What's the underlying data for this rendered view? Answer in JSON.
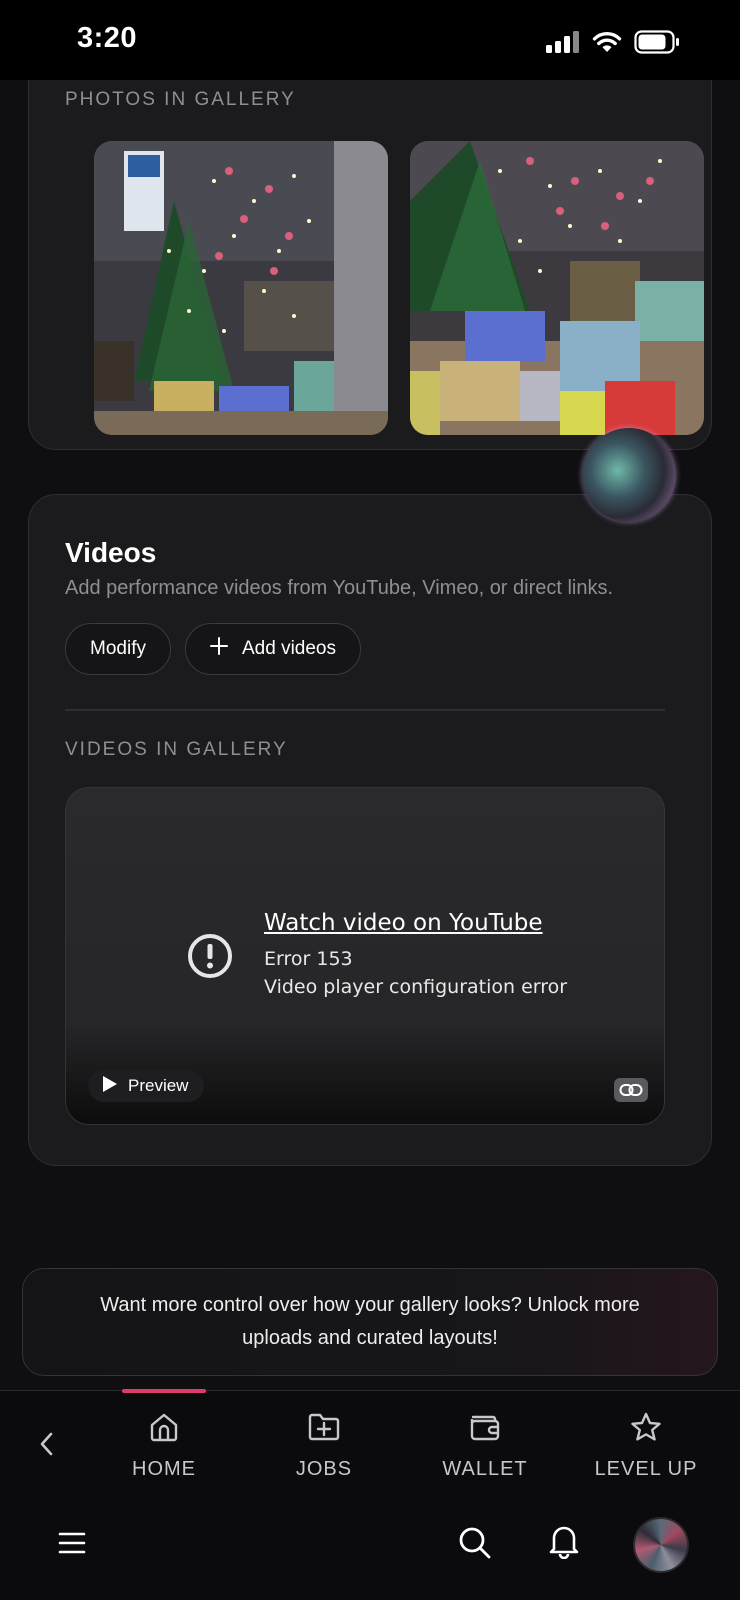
{
  "status_bar": {
    "time": "3:20"
  },
  "photos_section": {
    "label": "PHOTOS IN GALLERY"
  },
  "videos_section": {
    "title": "Videos",
    "description": "Add performance videos from YouTube, Vimeo, or direct links.",
    "modify_label": "Modify",
    "add_label": "Add videos",
    "gallery_label": "VIDEOS IN GALLERY",
    "player": {
      "link_text": "Watch video on YouTube",
      "error_code": "Error 153",
      "error_message": "Video player configuration error",
      "preview_label": "Preview"
    }
  },
  "promo": {
    "text": "Want more control over how your gallery looks? Unlock more uploads and curated layouts!"
  },
  "tab_bar": {
    "tabs": [
      {
        "label": "HOME",
        "icon": "home-icon"
      },
      {
        "label": "JOBS",
        "icon": "folder-plus-icon"
      },
      {
        "label": "WALLET",
        "icon": "wallet-icon"
      },
      {
        "label": "LEVEL UP",
        "icon": "star-icon"
      }
    ],
    "active_tab": "HOME",
    "accent_color": "#e03a6a"
  }
}
